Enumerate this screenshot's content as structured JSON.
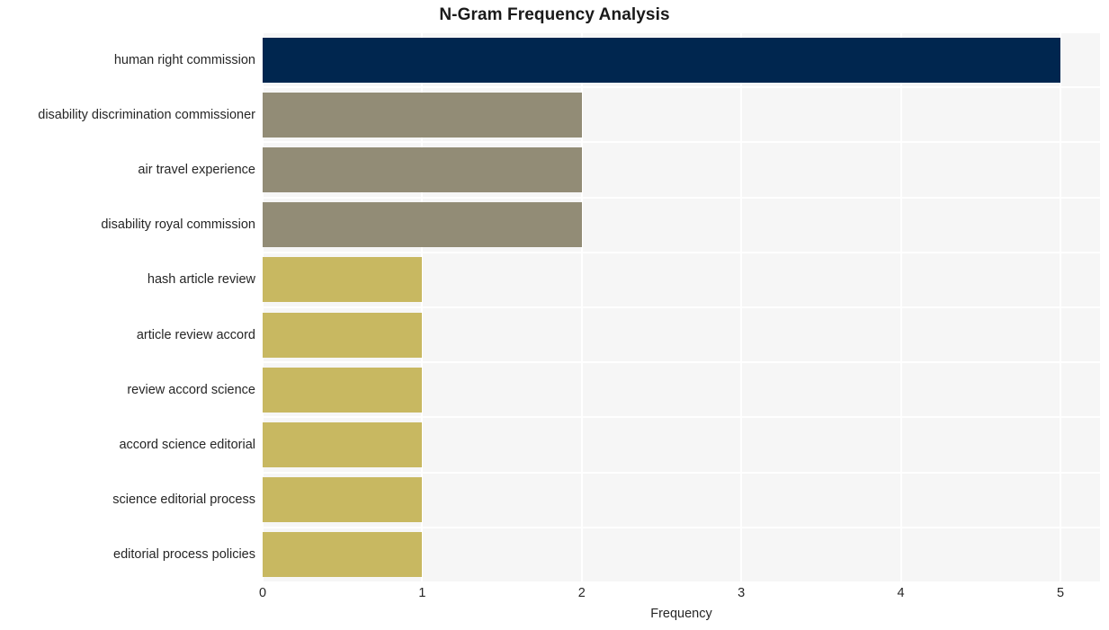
{
  "chart_data": {
    "type": "bar",
    "orientation": "horizontal",
    "title": "N-Gram Frequency Analysis",
    "xlabel": "Frequency",
    "ylabel": "",
    "categories": [
      "human right commission",
      "disability discrimination commissioner",
      "air travel experience",
      "disability royal commission",
      "hash article review",
      "article review accord",
      "review accord science",
      "accord science editorial",
      "science editorial process",
      "editorial process policies"
    ],
    "values": [
      5,
      2,
      2,
      2,
      1,
      1,
      1,
      1,
      1,
      1
    ],
    "bar_colors": [
      "#00264f",
      "#928c76",
      "#928c76",
      "#928c76",
      "#c8b861",
      "#c8b861",
      "#c8b861",
      "#c8b861",
      "#c8b861",
      "#c8b861"
    ],
    "xlim": [
      0,
      5
    ],
    "xticks": [
      0,
      1,
      2,
      3,
      4,
      5
    ],
    "xtick_labels": [
      "0",
      "1",
      "2",
      "3",
      "4",
      "5"
    ],
    "grid": true,
    "grid_color": "#ffffff",
    "plot_background": "#f6f6f6",
    "figure_background": "#ffffff",
    "legend": null
  }
}
